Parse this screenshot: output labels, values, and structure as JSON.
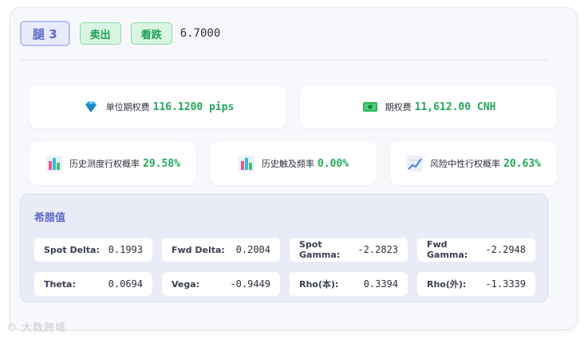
{
  "header": {
    "leg_label": "腿 3",
    "side_label": "卖出",
    "direction_label": "看跌",
    "strike": "6.7000"
  },
  "premium": {
    "unit_label": "单位期权费",
    "unit_value": "116.1200 pips",
    "total_label": "期权费",
    "total_value": "11,612.00 CNH"
  },
  "probabilities": {
    "hist_exercise_label": "历史测度行权概率",
    "hist_exercise_value": "29.58%",
    "hist_touch_label": "历史触及频率",
    "hist_touch_value": "0.00%",
    "risk_neutral_label": "风险中性行权概率",
    "risk_neutral_value": "20.63%"
  },
  "greeks": {
    "title": "希腊值",
    "items": [
      {
        "name": "Spot Delta:",
        "value": "0.1993"
      },
      {
        "name": "Fwd Delta:",
        "value": "0.2004"
      },
      {
        "name": "Spot Gamma:",
        "value": "-2.2823"
      },
      {
        "name": "Fwd Gamma:",
        "value": "-2.2948"
      },
      {
        "name": "Theta:",
        "value": "0.0694"
      },
      {
        "name": "Vega:",
        "value": "-0.9449"
      },
      {
        "name": "Rho(本):",
        "value": "0.3394"
      },
      {
        "name": "Rho(外):",
        "value": "-1.3339"
      }
    ]
  },
  "watermark": "© 大数跨境",
  "colors": {
    "accent": "#5d68c8",
    "positive": "#22a75b",
    "badge_green_bg": "#d9f6e3"
  },
  "icons": {
    "unit_premium": "gem-icon",
    "total_premium": "money-icon",
    "hist_exercise": "bar-chart-icon",
    "hist_touch": "bar-chart-icon",
    "risk_neutral": "line-chart-icon"
  }
}
